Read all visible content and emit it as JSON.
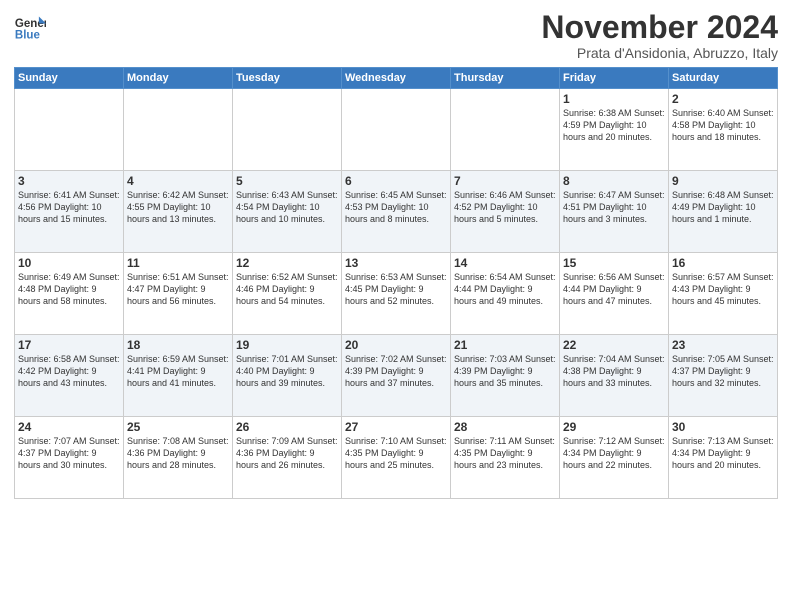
{
  "header": {
    "logo_line1": "General",
    "logo_line2": "Blue",
    "title": "November 2024",
    "location": "Prata d'Ansidonia, Abruzzo, Italy"
  },
  "days_of_week": [
    "Sunday",
    "Monday",
    "Tuesday",
    "Wednesday",
    "Thursday",
    "Friday",
    "Saturday"
  ],
  "weeks": [
    [
      {
        "day": "",
        "info": ""
      },
      {
        "day": "",
        "info": ""
      },
      {
        "day": "",
        "info": ""
      },
      {
        "day": "",
        "info": ""
      },
      {
        "day": "",
        "info": ""
      },
      {
        "day": "1",
        "info": "Sunrise: 6:38 AM\nSunset: 4:59 PM\nDaylight: 10 hours\nand 20 minutes."
      },
      {
        "day": "2",
        "info": "Sunrise: 6:40 AM\nSunset: 4:58 PM\nDaylight: 10 hours\nand 18 minutes."
      }
    ],
    [
      {
        "day": "3",
        "info": "Sunrise: 6:41 AM\nSunset: 4:56 PM\nDaylight: 10 hours\nand 15 minutes."
      },
      {
        "day": "4",
        "info": "Sunrise: 6:42 AM\nSunset: 4:55 PM\nDaylight: 10 hours\nand 13 minutes."
      },
      {
        "day": "5",
        "info": "Sunrise: 6:43 AM\nSunset: 4:54 PM\nDaylight: 10 hours\nand 10 minutes."
      },
      {
        "day": "6",
        "info": "Sunrise: 6:45 AM\nSunset: 4:53 PM\nDaylight: 10 hours\nand 8 minutes."
      },
      {
        "day": "7",
        "info": "Sunrise: 6:46 AM\nSunset: 4:52 PM\nDaylight: 10 hours\nand 5 minutes."
      },
      {
        "day": "8",
        "info": "Sunrise: 6:47 AM\nSunset: 4:51 PM\nDaylight: 10 hours\nand 3 minutes."
      },
      {
        "day": "9",
        "info": "Sunrise: 6:48 AM\nSunset: 4:49 PM\nDaylight: 10 hours\nand 1 minute."
      }
    ],
    [
      {
        "day": "10",
        "info": "Sunrise: 6:49 AM\nSunset: 4:48 PM\nDaylight: 9 hours\nand 58 minutes."
      },
      {
        "day": "11",
        "info": "Sunrise: 6:51 AM\nSunset: 4:47 PM\nDaylight: 9 hours\nand 56 minutes."
      },
      {
        "day": "12",
        "info": "Sunrise: 6:52 AM\nSunset: 4:46 PM\nDaylight: 9 hours\nand 54 minutes."
      },
      {
        "day": "13",
        "info": "Sunrise: 6:53 AM\nSunset: 4:45 PM\nDaylight: 9 hours\nand 52 minutes."
      },
      {
        "day": "14",
        "info": "Sunrise: 6:54 AM\nSunset: 4:44 PM\nDaylight: 9 hours\nand 49 minutes."
      },
      {
        "day": "15",
        "info": "Sunrise: 6:56 AM\nSunset: 4:44 PM\nDaylight: 9 hours\nand 47 minutes."
      },
      {
        "day": "16",
        "info": "Sunrise: 6:57 AM\nSunset: 4:43 PM\nDaylight: 9 hours\nand 45 minutes."
      }
    ],
    [
      {
        "day": "17",
        "info": "Sunrise: 6:58 AM\nSunset: 4:42 PM\nDaylight: 9 hours\nand 43 minutes."
      },
      {
        "day": "18",
        "info": "Sunrise: 6:59 AM\nSunset: 4:41 PM\nDaylight: 9 hours\nand 41 minutes."
      },
      {
        "day": "19",
        "info": "Sunrise: 7:01 AM\nSunset: 4:40 PM\nDaylight: 9 hours\nand 39 minutes."
      },
      {
        "day": "20",
        "info": "Sunrise: 7:02 AM\nSunset: 4:39 PM\nDaylight: 9 hours\nand 37 minutes."
      },
      {
        "day": "21",
        "info": "Sunrise: 7:03 AM\nSunset: 4:39 PM\nDaylight: 9 hours\nand 35 minutes."
      },
      {
        "day": "22",
        "info": "Sunrise: 7:04 AM\nSunset: 4:38 PM\nDaylight: 9 hours\nand 33 minutes."
      },
      {
        "day": "23",
        "info": "Sunrise: 7:05 AM\nSunset: 4:37 PM\nDaylight: 9 hours\nand 32 minutes."
      }
    ],
    [
      {
        "day": "24",
        "info": "Sunrise: 7:07 AM\nSunset: 4:37 PM\nDaylight: 9 hours\nand 30 minutes."
      },
      {
        "day": "25",
        "info": "Sunrise: 7:08 AM\nSunset: 4:36 PM\nDaylight: 9 hours\nand 28 minutes."
      },
      {
        "day": "26",
        "info": "Sunrise: 7:09 AM\nSunset: 4:36 PM\nDaylight: 9 hours\nand 26 minutes."
      },
      {
        "day": "27",
        "info": "Sunrise: 7:10 AM\nSunset: 4:35 PM\nDaylight: 9 hours\nand 25 minutes."
      },
      {
        "day": "28",
        "info": "Sunrise: 7:11 AM\nSunset: 4:35 PM\nDaylight: 9 hours\nand 23 minutes."
      },
      {
        "day": "29",
        "info": "Sunrise: 7:12 AM\nSunset: 4:34 PM\nDaylight: 9 hours\nand 22 minutes."
      },
      {
        "day": "30",
        "info": "Sunrise: 7:13 AM\nSunset: 4:34 PM\nDaylight: 9 hours\nand 20 minutes."
      }
    ]
  ]
}
